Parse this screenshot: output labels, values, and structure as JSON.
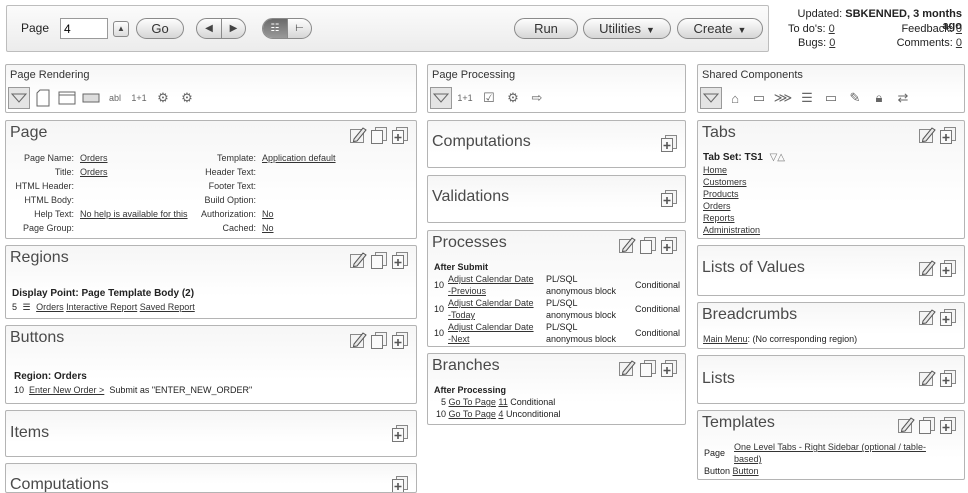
{
  "toolbar": {
    "page_label": "Page",
    "page_value": "4",
    "go_label": "Go",
    "run_label": "Run",
    "utilities_label": "Utilities",
    "create_label": "Create",
    "icons": [
      "up-arrow-icon",
      "prev-icon",
      "next-icon",
      "detail-view-icon",
      "tree-view-icon"
    ]
  },
  "status": {
    "updated_label": "Updated:",
    "updated_value": "SBKENNED, 3 months ago",
    "todos_label": "To do's:",
    "todos_value": "0",
    "feedback_label": "Feedback:",
    "feedback_value": "0",
    "bugs_label": "Bugs:",
    "bugs_value": "0",
    "comments_label": "Comments:",
    "comments_value": "0"
  },
  "columns": {
    "rendering": {
      "title": "Page Rendering"
    },
    "processing": {
      "title": "Page Processing"
    },
    "shared": {
      "title": "Shared Components"
    }
  },
  "page_panel": {
    "title": "Page",
    "left": [
      {
        "k": "Page Name:",
        "v": "Orders",
        "link": true
      },
      {
        "k": "Title:",
        "v": "Orders",
        "link": true
      },
      {
        "k": "HTML Header:",
        "v": "",
        "link": false
      },
      {
        "k": "HTML Body:",
        "v": "",
        "link": false
      },
      {
        "k": "Help Text:",
        "v": "No help is available for this",
        "link": true
      },
      {
        "k": "Page Group:",
        "v": "",
        "link": false
      }
    ],
    "right": [
      {
        "k": "Template:",
        "v": "Application default",
        "link": true
      },
      {
        "k": "Header Text:",
        "v": "",
        "link": false
      },
      {
        "k": "Footer Text:",
        "v": "",
        "link": false
      },
      {
        "k": "Build Option:",
        "v": "",
        "link": false
      },
      {
        "k": "Authorization:",
        "v": "No",
        "link": true
      },
      {
        "k": "Cached:",
        "v": "No",
        "link": true
      }
    ]
  },
  "regions_panel": {
    "title": "Regions",
    "display_point": "Display Point: Page Template Body (2)",
    "seq": "5",
    "name": "Orders",
    "type": "Interactive Report",
    "extra": "Saved Report"
  },
  "buttons_panel": {
    "title": "Buttons",
    "region": "Region: Orders",
    "seq": "10",
    "name": "Enter New Order >",
    "desc": "Submit as \"ENTER_NEW_ORDER\""
  },
  "items_panel": {
    "title": "Items"
  },
  "computations_left_panel": {
    "title": "Computations"
  },
  "computations_panel": {
    "title": "Computations"
  },
  "validations_panel": {
    "title": "Validations"
  },
  "processes_panel": {
    "title": "Processes",
    "group": "After Submit",
    "rows": [
      {
        "seq": "10",
        "name1": "Adjust Calendar Date",
        "name2": "-Previous",
        "type1": "PL/SQL",
        "type2": "anonymous block",
        "cond": "Conditional"
      },
      {
        "seq": "10",
        "name1": "Adjust Calendar Date",
        "name2": "-Today",
        "type1": "PL/SQL",
        "type2": "anonymous block",
        "cond": "Conditional"
      },
      {
        "seq": "10",
        "name1": "Adjust Calendar Date",
        "name2": "-Next",
        "type1": "PL/SQL",
        "type2": "anonymous block",
        "cond": "Conditional"
      }
    ]
  },
  "branches_panel": {
    "title": "Branches",
    "group": "After Processing",
    "rows": [
      {
        "seq": "5",
        "name": "Go To Page",
        "page": "11",
        "cond": "Conditional"
      },
      {
        "seq": "10",
        "name": "Go To Page",
        "page": "4",
        "cond": "Unconditional"
      }
    ]
  },
  "tabs_panel": {
    "title": "Tabs",
    "tab_set": "Tab Set: TS1",
    "items": [
      "Home",
      "Customers",
      "Products",
      "Orders",
      "Reports",
      "Administration"
    ]
  },
  "lov_panel": {
    "title": "Lists of Values"
  },
  "breadcrumbs_panel": {
    "title": "Breadcrumbs",
    "menu": "Main Menu",
    "note": ": (No corresponding region)"
  },
  "lists_panel": {
    "title": "Lists"
  },
  "templates_panel": {
    "title": "Templates",
    "page_label": "Page",
    "page_value1": "One Level Tabs - Right Sidebar (optional / table-",
    "page_value2": "based)",
    "button_label": "Button",
    "button_value": "Button"
  }
}
